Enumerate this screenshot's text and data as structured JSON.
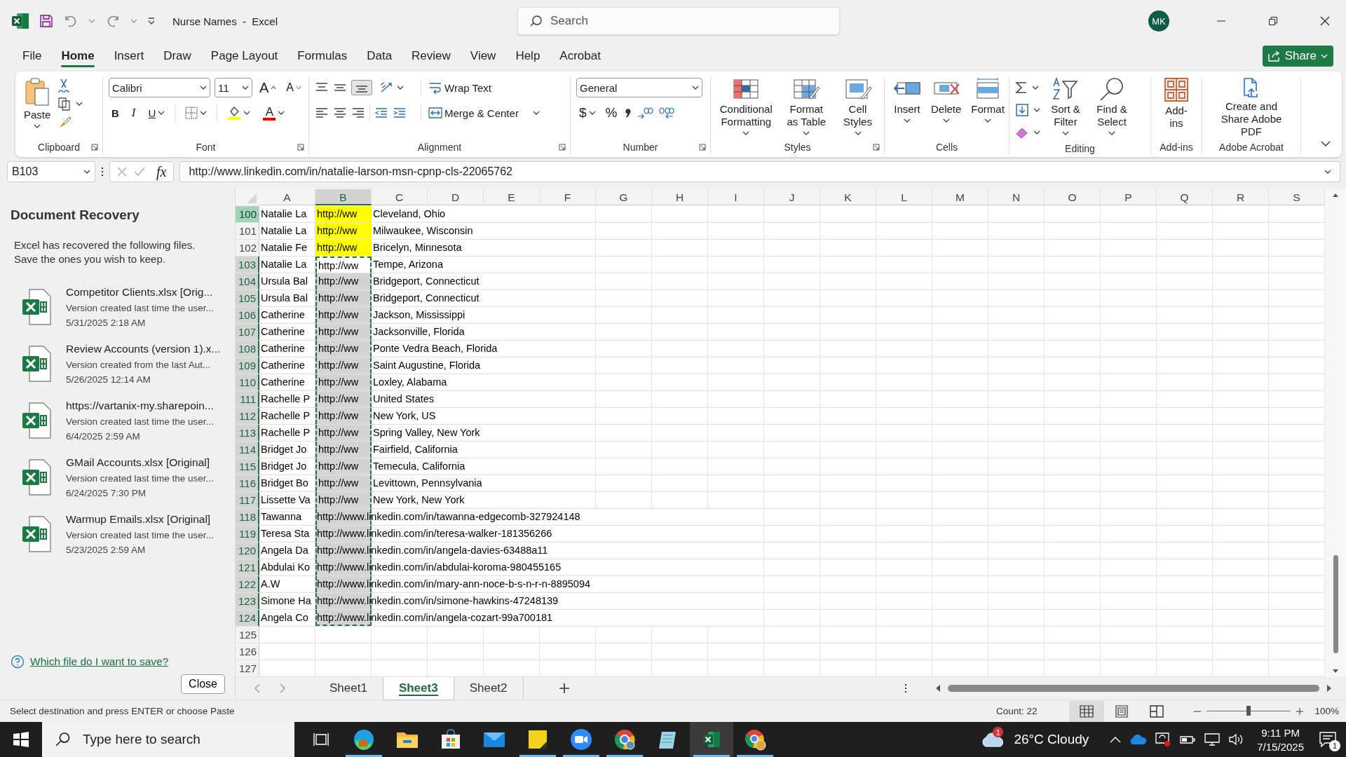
{
  "window": {
    "title": "Nurse Names  -  Excel",
    "search_placeholder": "Search",
    "user_initials": "MK"
  },
  "ribbon_tabs": [
    {
      "label": "File",
      "selected": false
    },
    {
      "label": "Home",
      "selected": true
    },
    {
      "label": "Insert",
      "selected": false
    },
    {
      "label": "Draw",
      "selected": false
    },
    {
      "label": "Page Layout",
      "selected": false
    },
    {
      "label": "Formulas",
      "selected": false
    },
    {
      "label": "Data",
      "selected": false
    },
    {
      "label": "Review",
      "selected": false
    },
    {
      "label": "View",
      "selected": false
    },
    {
      "label": "Help",
      "selected": false
    },
    {
      "label": "Acrobat",
      "selected": false
    }
  ],
  "share_button": "Share",
  "ribbon": {
    "clipboard": {
      "label": "Clipboard",
      "paste": "Paste"
    },
    "font": {
      "label": "Font",
      "font_name": "Calibri",
      "font_size": "11",
      "grow": "A",
      "shrink": "A",
      "bold": "B",
      "italic": "I",
      "underline": "U",
      "font_color": "A"
    },
    "alignment": {
      "label": "Alignment",
      "bottom_align_on": true,
      "wrap_text": "Wrap Text",
      "merge_center": "Merge & Center"
    },
    "number": {
      "label": "Number",
      "format": "General",
      "currency": "$",
      "percent": "%"
    },
    "styles": {
      "label": "Styles",
      "buttons": [
        "Conditional Formatting",
        "Format as Table",
        "Cell Styles"
      ]
    },
    "cells": {
      "label": "Cells",
      "buttons": [
        "Insert",
        "Delete",
        "Format"
      ]
    },
    "editing": {
      "label": "Editing",
      "buttons": [
        "Sort & Filter",
        "Find & Select"
      ]
    },
    "addins": {
      "label": "Add-ins",
      "button": "Add-ins"
    },
    "acrobat": {
      "label": "Adobe Acrobat",
      "button": "Create and Share Adobe PDF"
    }
  },
  "formula_bar": {
    "name_box": "B103",
    "fx": "fx",
    "formula": "http://www.linkedin.com/in/natalie-larson-msn-cpnp-cls-22065762"
  },
  "recovery_pane": {
    "title": "Document Recovery",
    "message": "Excel has recovered the following files. Save the ones you wish to keep.",
    "files": [
      {
        "name": "Competitor Clients.xlsx  [Orig...",
        "description": "Version created last time the user...",
        "date": "5/31/2025 2:18 AM"
      },
      {
        "name": "Review Accounts (version 1).x...",
        "description": "Version created from the last Aut...",
        "date": "5/26/2025 12:14 AM"
      },
      {
        "name": "https://vartanix-my.sharepoin...",
        "description": "Version created last time the user...",
        "date": "6/4/2025 2:59 AM"
      },
      {
        "name": "GMail Accounts.xlsx  [Original]",
        "description": "Version created last time the user...",
        "date": "6/24/2025 7:30 PM"
      },
      {
        "name": "Warmup Emails.xlsx  [Original]",
        "description": "Version created last time the user...",
        "date": "5/23/2025 2:59 AM"
      }
    ],
    "help_link": "Which file do I want to save?",
    "close_button": "Close"
  },
  "grid": {
    "columns": [
      {
        "label": "A",
        "selected": false
      },
      {
        "label": "B",
        "selected": true
      },
      {
        "label": "C",
        "selected": false
      },
      {
        "label": "D",
        "selected": false
      },
      {
        "label": "E",
        "selected": false
      },
      {
        "label": "F",
        "selected": false
      },
      {
        "label": "G",
        "selected": false
      },
      {
        "label": "H",
        "selected": false
      },
      {
        "label": "I",
        "selected": false
      },
      {
        "label": "J",
        "selected": false
      },
      {
        "label": "K",
        "selected": false
      },
      {
        "label": "L",
        "selected": false
      },
      {
        "label": "M",
        "selected": false
      },
      {
        "label": "N",
        "selected": false
      },
      {
        "label": "O",
        "selected": false
      },
      {
        "label": "P",
        "selected": false
      },
      {
        "label": "Q",
        "selected": false
      },
      {
        "label": "R",
        "selected": false
      },
      {
        "label": "S",
        "selected": false
      }
    ],
    "rows": [
      {
        "header": "100",
        "name": "Natalie La",
        "url": "http://ww",
        "location": "Cleveland, Ohio",
        "highlighted": true,
        "selected": false,
        "active": false,
        "marked": true
      },
      {
        "header": "101",
        "name": "Natalie La",
        "url": "http://ww",
        "location": "Milwaukee, Wisconsin",
        "highlighted": true,
        "selected": false,
        "active": false,
        "marked": false
      },
      {
        "header": "102",
        "name": "Natalie Fe",
        "url": "http://ww",
        "location": "Bricelyn, Minnesota",
        "highlighted": true,
        "selected": false,
        "active": false,
        "marked": false
      },
      {
        "header": "103",
        "name": "Natalie La",
        "url": "http://ww",
        "location": "Tempe, Arizona",
        "highlighted": false,
        "selected": true,
        "active": true,
        "marked": false
      },
      {
        "header": "104",
        "name": "Ursula Bal",
        "url": "http://ww",
        "location": "Bridgeport, Connecticut",
        "highlighted": false,
        "selected": true,
        "active": false,
        "marked": false
      },
      {
        "header": "105",
        "name": "Ursula Bal",
        "url": "http://ww",
        "location": "Bridgeport, Connecticut",
        "highlighted": false,
        "selected": true,
        "active": false,
        "marked": false
      },
      {
        "header": "106",
        "name": "Catherine",
        "url": "http://ww",
        "location": "Jackson, Mississippi",
        "highlighted": false,
        "selected": true,
        "active": false,
        "marked": false
      },
      {
        "header": "107",
        "name": "Catherine",
        "url": "http://ww",
        "location": "Jacksonville, Florida",
        "highlighted": false,
        "selected": true,
        "active": false,
        "marked": false
      },
      {
        "header": "108",
        "name": "Catherine",
        "url": "http://ww",
        "location": "Ponte Vedra Beach, Florida",
        "highlighted": false,
        "selected": true,
        "active": false,
        "marked": false
      },
      {
        "header": "109",
        "name": "Catherine",
        "url": "http://ww",
        "location": "Saint Augustine, Florida",
        "highlighted": false,
        "selected": true,
        "active": false,
        "marked": false
      },
      {
        "header": "110",
        "name": "Catherine",
        "url": "http://ww",
        "location": "Loxley, Alabama",
        "highlighted": false,
        "selected": true,
        "active": false,
        "marked": false
      },
      {
        "header": "111",
        "name": "Rachelle P",
        "url": "http://ww",
        "location": "United States",
        "highlighted": false,
        "selected": true,
        "active": false,
        "marked": false
      },
      {
        "header": "112",
        "name": "Rachelle P",
        "url": "http://ww",
        "location": "New York, US",
        "highlighted": false,
        "selected": true,
        "active": false,
        "marked": false
      },
      {
        "header": "113",
        "name": "Rachelle P",
        "url": "http://ww",
        "location": "Spring Valley, New York",
        "highlighted": false,
        "selected": true,
        "active": false,
        "marked": false
      },
      {
        "header": "114",
        "name": "Bridget Jo",
        "url": "http://ww",
        "location": "Fairfield, California",
        "highlighted": false,
        "selected": true,
        "active": false,
        "marked": false
      },
      {
        "header": "115",
        "name": "Bridget Jo",
        "url": "http://ww",
        "location": "Temecula, California",
        "highlighted": false,
        "selected": true,
        "active": false,
        "marked": false
      },
      {
        "header": "116",
        "name": "Bridget Bo",
        "url": "http://ww",
        "location": "Levittown, Pennsylvania",
        "highlighted": false,
        "selected": true,
        "active": false,
        "marked": false
      },
      {
        "header": "117",
        "name": "Lissette Va",
        "url": "http://ww",
        "location": "New York, New York",
        "highlighted": false,
        "selected": true,
        "active": false,
        "marked": false
      },
      {
        "header": "118",
        "name": "Tawanna",
        "url": "http://www.linkedin.com/in/tawanna-edgecomb-327924148",
        "highlighted": false,
        "selected": true,
        "active": false,
        "marked": false
      },
      {
        "header": "119",
        "name": "Teresa Sta",
        "url": "http://www.linkedin.com/in/teresa-walker-181356266",
        "highlighted": false,
        "selected": true,
        "active": false,
        "marked": false
      },
      {
        "header": "120",
        "name": "Angela Da",
        "url": "http://www.linkedin.com/in/angela-davies-63488a11",
        "highlighted": false,
        "selected": true,
        "active": false,
        "marked": false
      },
      {
        "header": "121",
        "name": "Abdulai Ko",
        "url": "http://www.linkedin.com/in/abdulai-koroma-980455165",
        "highlighted": false,
        "selected": true,
        "active": false,
        "marked": false
      },
      {
        "header": "122",
        "name": "A.W",
        "url": "http://www.linkedin.com/in/mary-ann-noce-b-s-n-r-n-8895094",
        "highlighted": false,
        "selected": true,
        "active": false,
        "marked": false
      },
      {
        "header": "123",
        "name": "Simone Ha",
        "url": "http://www.linkedin.com/in/simone-hawkins-47248139",
        "highlighted": false,
        "selected": true,
        "active": false,
        "marked": false
      },
      {
        "header": "124",
        "name": "Angela Co",
        "url": "http://www.linkedin.com/in/angela-cozart-99a700181",
        "highlighted": false,
        "selected": true,
        "active": false,
        "marked": false
      }
    ],
    "empty_rows": [
      "125",
      "126",
      "127"
    ]
  },
  "sheet_tabs": [
    {
      "label": "Sheet1",
      "selected": false
    },
    {
      "label": "Sheet3",
      "selected": true
    },
    {
      "label": "Sheet2",
      "selected": false
    }
  ],
  "status_bar": {
    "message": "Select destination and press ENTER or choose Paste",
    "count": "Count: 22",
    "views": [
      {
        "kind": "normal",
        "selected": true
      },
      {
        "kind": "page_layout",
        "selected": false
      },
      {
        "kind": "page_break",
        "selected": false
      }
    ],
    "zoom_slider": {
      "level": 0.5
    },
    "zoom": "100%"
  },
  "taskbar": {
    "search_placeholder": "Type here to search",
    "apps": [
      {
        "kind": "edge",
        "running": true,
        "active": false
      },
      {
        "kind": "explorer",
        "running": false,
        "active": false
      },
      {
        "kind": "store",
        "running": false,
        "active": false
      },
      {
        "kind": "mail",
        "running": false,
        "active": false
      },
      {
        "kind": "sticky",
        "running": true,
        "active": false
      },
      {
        "kind": "zoom",
        "running": true,
        "active": false
      },
      {
        "kind": "chrome",
        "running": true,
        "active": false
      },
      {
        "kind": "notepad",
        "running": false,
        "active": false
      },
      {
        "kind": "excel",
        "running": true,
        "active": true
      },
      {
        "kind": "chrome_profile",
        "running": true,
        "active": false
      }
    ],
    "weather": {
      "badge": "1",
      "text": "26°C  Cloudy"
    },
    "time": "9:11 PM",
    "date": "7/15/2025",
    "notifications": "1"
  }
}
